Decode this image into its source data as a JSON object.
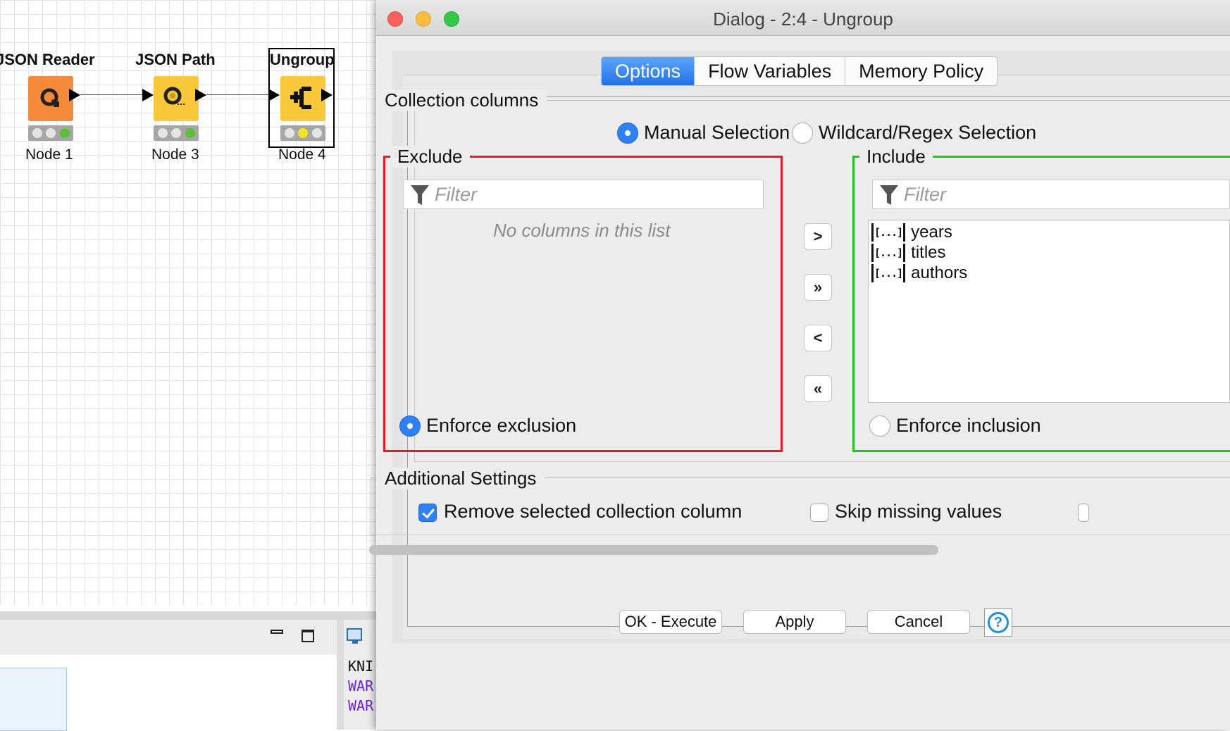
{
  "workflow": {
    "nodes": [
      {
        "title": "JSON Reader",
        "label": "Node 1",
        "color": "#f58a3a",
        "status": "green"
      },
      {
        "title": "JSON Path",
        "label": "Node 3",
        "color": "#f9c83a",
        "status": "green"
      },
      {
        "title": "Ungroup",
        "label": "Node 4",
        "color": "#f9c83a",
        "status": "yellow"
      }
    ]
  },
  "console": {
    "lines": [
      "KNI",
      "WAR",
      "WAR"
    ],
    "warn_color": "#6a24d6"
  },
  "dialog": {
    "title": "Dialog - 2:4 - Ungroup",
    "tabs": [
      {
        "label": "Options",
        "active": true
      },
      {
        "label": "Flow Variables",
        "active": false
      },
      {
        "label": "Memory Policy",
        "active": false
      }
    ],
    "collection_columns": {
      "title": "Collection columns",
      "mode_manual": "Manual Selection",
      "mode_wildcard": "Wildcard/Regex Selection",
      "selected_mode": "manual",
      "exclude": {
        "title": "Exclude",
        "filter_placeholder": "Filter",
        "empty_message": "No columns in this list",
        "enforce_label": "Enforce exclusion",
        "enforce_checked": true
      },
      "include": {
        "title": "Include",
        "filter_placeholder": "Filter",
        "items": [
          {
            "icon": "[...]",
            "name": "years"
          },
          {
            "icon": "[...]",
            "name": "titles"
          },
          {
            "icon": "[...]",
            "name": "authors"
          }
        ],
        "enforce_label": "Enforce inclusion",
        "enforce_checked": false
      },
      "move_buttons": [
        ">",
        "»",
        "<",
        "«"
      ]
    },
    "additional_settings": {
      "title": "Additional Settings",
      "remove_selected_label": "Remove selected collection column",
      "remove_selected_checked": true,
      "skip_missing_label": "Skip missing values",
      "skip_missing_checked": false
    },
    "buttons": {
      "ok": "OK - Execute",
      "apply": "Apply",
      "cancel": "Cancel",
      "help": "?"
    },
    "colors": {
      "accent": "#2f7ff5",
      "exclude_border": "#e51c23",
      "include_border": "#20c520"
    }
  }
}
